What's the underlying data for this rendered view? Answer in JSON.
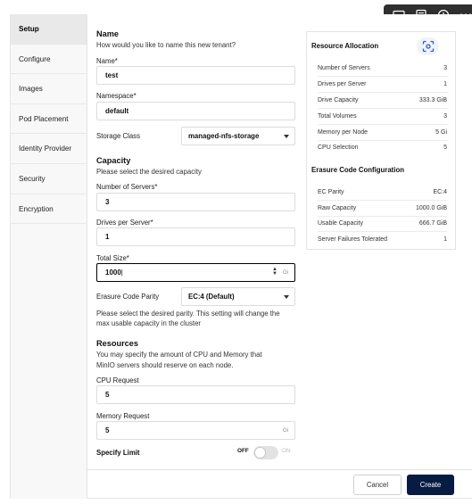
{
  "toolbar": {
    "icons": [
      "comment-icon",
      "text-panel-icon",
      "download-icon",
      "more-icon"
    ]
  },
  "sidebar": {
    "items": [
      {
        "label": "Setup",
        "active": true
      },
      {
        "label": "Configure"
      },
      {
        "label": "Images"
      },
      {
        "label": "Pod Placement"
      },
      {
        "label": "Identity Provider"
      },
      {
        "label": "Security"
      },
      {
        "label": "Encryption"
      }
    ]
  },
  "name_section": {
    "title": "Name",
    "subtitle": "How would you like to name this new tenant?",
    "name_label": "Name*",
    "name_value": "test",
    "namespace_label": "Namespace*",
    "namespace_value": "default",
    "storage_class_label": "Storage Class",
    "storage_class_value": "managed-nfs-storage"
  },
  "capacity_section": {
    "title": "Capacity",
    "subtitle": "Please select the desired capacity",
    "servers_label": "Number of Servers*",
    "servers_value": "3",
    "drives_label": "Drives per Server*",
    "drives_value": "1",
    "total_size_label": "Total Size*",
    "total_size_value": "1000",
    "total_size_unit": "Gi",
    "ec_label": "Erasure Code Parity",
    "ec_value": "EC:4 (Default)",
    "ec_help_line1": "Please select the desired parity. This setting will change the",
    "ec_help_line2": "max usable capacity in the cluster"
  },
  "resources_section": {
    "title": "Resources",
    "subtitle_line1": "You may specify the amount of CPU and Memory that",
    "subtitle_line2": "MinIO servers should reserve on each node.",
    "cpu_label": "CPU Request",
    "cpu_value": "5",
    "memory_label": "Memory Request",
    "memory_value": "5",
    "memory_unit": "Gi",
    "limit_label": "Specify Limit",
    "toggle_off": "OFF",
    "toggle_on": "ON",
    "limit_enabled": false
  },
  "allocation_panel": {
    "title": "Resource Allocation",
    "rows": [
      {
        "label": "Number of Servers",
        "value": "3"
      },
      {
        "label": "Drives per Server",
        "value": "1"
      },
      {
        "label": "Drive Capacity",
        "value": "333.3 GiB"
      },
      {
        "label": "Total Volumes",
        "value": "3"
      },
      {
        "label": "Memory per Node",
        "value": "5 Gi"
      },
      {
        "label": "CPU Selection",
        "value": "5"
      }
    ],
    "ec_title": "Erasure Code Configuration",
    "ec_rows": [
      {
        "label": "EC Parity",
        "value": "EC:4"
      },
      {
        "label": "Raw Capacity",
        "value": "1000.0 GiB"
      },
      {
        "label": "Usable Capacity",
        "value": "666.7 GiB"
      },
      {
        "label": "Server Failures Tolerated",
        "value": "1"
      }
    ]
  },
  "footer": {
    "cancel_label": "Cancel",
    "create_label": "Create"
  },
  "colors": {
    "primary": "#081c42",
    "sidebar_bg": "#f8f8f8",
    "active_item_bg": "#e9e9e9"
  }
}
